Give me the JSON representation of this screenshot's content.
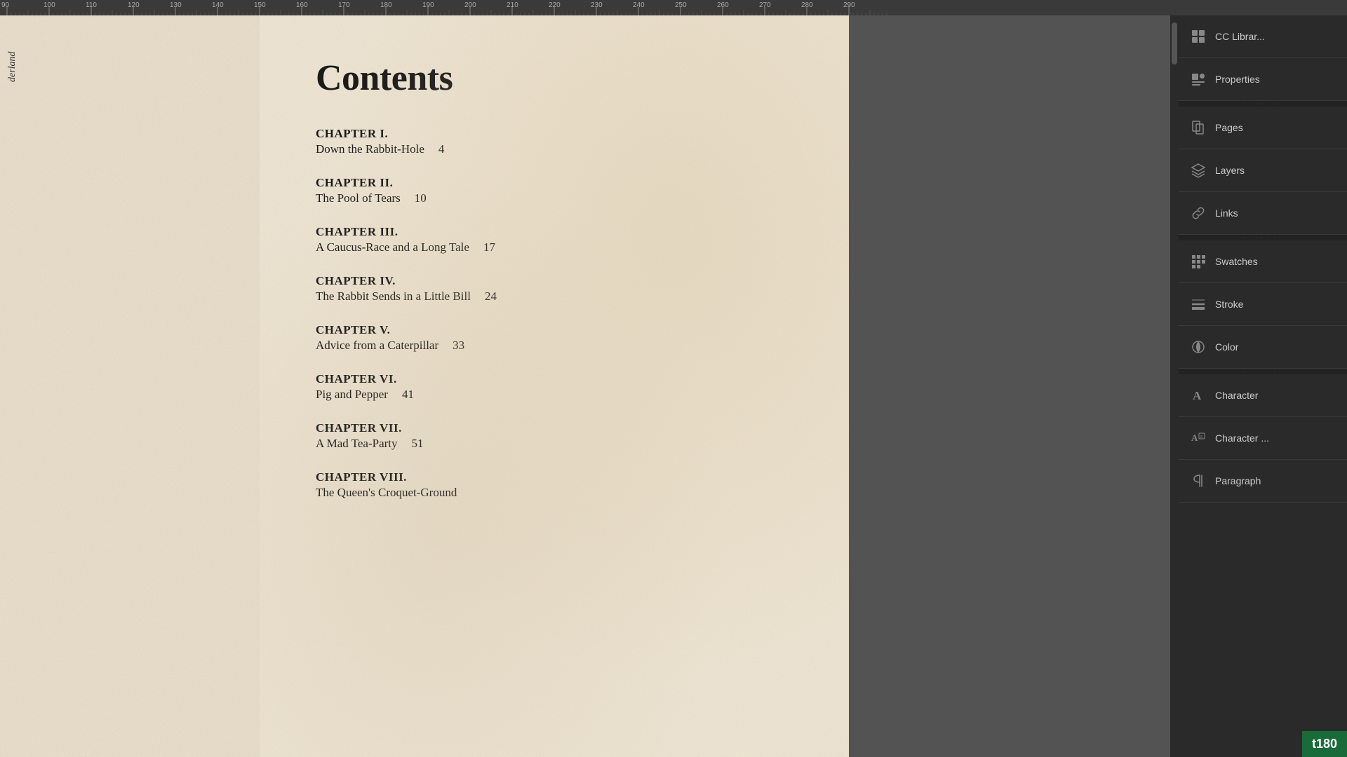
{
  "ruler": {
    "ticks": [
      "90",
      "100",
      "110",
      "120",
      "130",
      "140",
      "150",
      "160",
      "170",
      "180",
      "190",
      "200",
      "210",
      "220",
      "230",
      "240",
      "250",
      "260",
      "270",
      "280",
      "290"
    ]
  },
  "left_page": {
    "partial_text": "derland"
  },
  "right_page": {
    "title": "Contents",
    "chapters": [
      {
        "number": "CHAPTER I.",
        "name": "Down the Rabbit-Hole",
        "page": "4"
      },
      {
        "number": "CHAPTER II.",
        "name": "The Pool of Tears",
        "page": "10"
      },
      {
        "number": "CHAPTER III.",
        "name": "A Caucus-Race and a Long Tale",
        "page": "17"
      },
      {
        "number": "CHAPTER IV.",
        "name": "The Rabbit Sends in a Little Bill",
        "page": "24"
      },
      {
        "number": "CHAPTER V.",
        "name": "Advice from a Caterpillar",
        "page": "33"
      },
      {
        "number": "CHAPTER VI.",
        "name": "Pig and Pepper",
        "page": "41"
      },
      {
        "number": "CHAPTER VII.",
        "name": "A Mad Tea-Party",
        "page": "51"
      },
      {
        "number": "CHAPTER VIII.",
        "name": "The Queen's Croquet-Ground",
        "page": ""
      }
    ]
  },
  "right_panel": {
    "items": [
      {
        "id": "cc-libraries",
        "label": "CC Librar...",
        "icon": "cc-libraries-icon"
      },
      {
        "id": "properties",
        "label": "Properties",
        "icon": "properties-icon"
      },
      {
        "id": "pages",
        "label": "Pages",
        "icon": "pages-icon"
      },
      {
        "id": "layers",
        "label": "Layers",
        "icon": "layers-icon"
      },
      {
        "id": "links",
        "label": "Links",
        "icon": "links-icon"
      },
      {
        "id": "swatches",
        "label": "Swatches",
        "icon": "swatches-icon"
      },
      {
        "id": "stroke",
        "label": "Stroke",
        "icon": "stroke-icon"
      },
      {
        "id": "color",
        "label": "Color",
        "icon": "color-icon"
      },
      {
        "id": "character",
        "label": "Character",
        "icon": "character-icon"
      },
      {
        "id": "ai-character",
        "label": "Character ...",
        "icon": "ai-character-icon"
      },
      {
        "id": "paragraph",
        "label": "Paragraph",
        "icon": "paragraph-icon"
      }
    ]
  },
  "bottom_badge": {
    "text": "t180"
  }
}
